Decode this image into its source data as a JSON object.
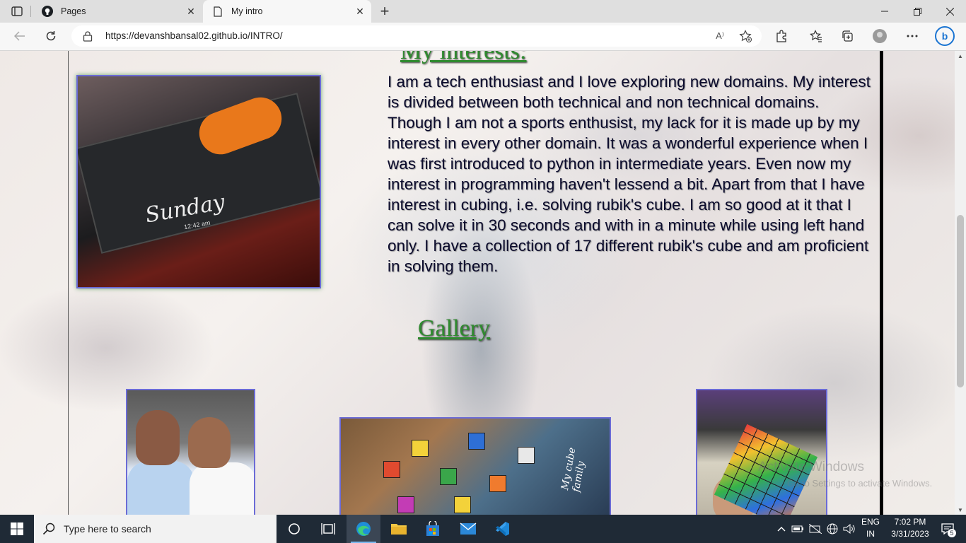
{
  "browser": {
    "tabs": [
      {
        "title": "Pages",
        "favicon": "github-icon"
      },
      {
        "title": "My intro",
        "favicon": "page-icon"
      }
    ],
    "url": "https://devanshbansal02.github.io/INTRO/",
    "read_aloud_label": "A⁾"
  },
  "page": {
    "interests_heading": "My interests:",
    "interests_text": "I am a tech enthusiast and I love exploring new domains. My interest is divided between both technical and non technical domains. Though I am not a sports enthusist, my lack for it is made up by my interest in every other domain. It was a wonderful experience when I was first introduced to python in intermediate years. Even now my interest in programming haven't lessend a bit. Apart from that I have interest in cubing, i.e. solving rubik's cube. I am so good at it that I can solve it in 30 seconds and with in a minute while using left hand only. I have a collection of 17 different rubik's cube and am proficient in solving them.",
    "interest_image_text": "Sunday",
    "interest_image_time": "12:42 am",
    "gallery_heading": "Gallery",
    "gallery_image_2_caption": "My cube family"
  },
  "watermark": {
    "line1": "Activate Windows",
    "line2": "Go to Settings to activate Windows."
  },
  "taskbar": {
    "search_placeholder": "Type here to search",
    "lang_line1": "ENG",
    "lang_line2": "IN",
    "time": "7:02 PM",
    "date": "3/31/2023",
    "notification_count": "5"
  }
}
